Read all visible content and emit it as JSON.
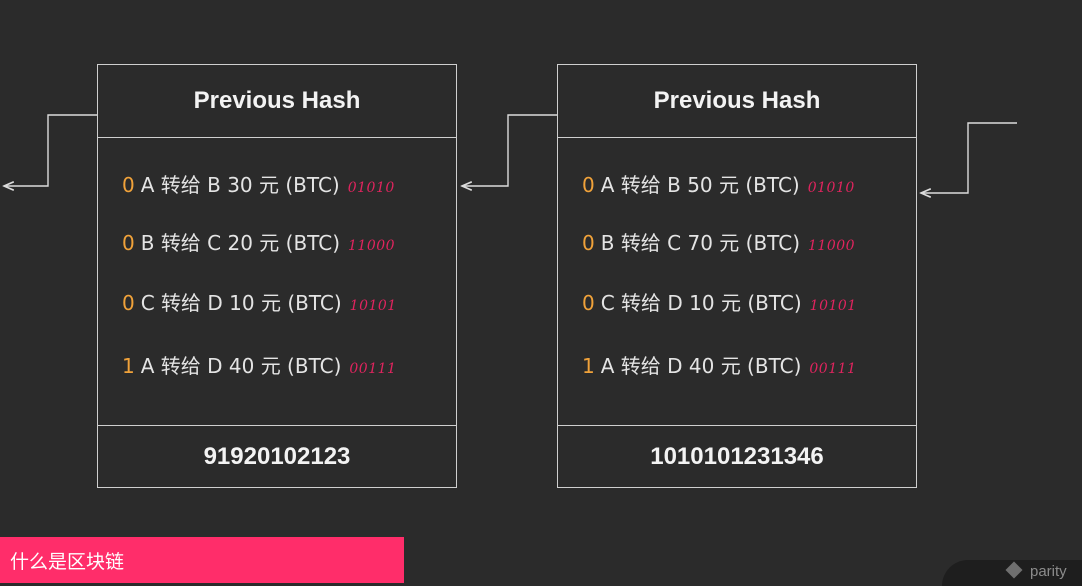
{
  "blocks": [
    {
      "header": "Previous Hash",
      "transactions": [
        {
          "flag": "0",
          "text": "A 转给 B 30 元 (BTC)",
          "bits": "01010"
        },
        {
          "flag": "0",
          "text": "B 转给 C 20 元 (BTC)",
          "bits": "11000"
        },
        {
          "flag": "0",
          "text": "C 转给 D 10 元 (BTC)",
          "bits": "10101"
        },
        {
          "flag": "1",
          "text": "A 转给 D 40 元 (BTC)",
          "bits": "00111"
        }
      ],
      "hash": "91920102123"
    },
    {
      "header": "Previous Hash",
      "transactions": [
        {
          "flag": "0",
          "text": "A 转给 B 50 元 (BTC)",
          "bits": "01010"
        },
        {
          "flag": "0",
          "text": "B 转给 C 70 元 (BTC)",
          "bits": "11000"
        },
        {
          "flag": "0",
          "text": "C 转给 D 10 元 (BTC)",
          "bits": "10101"
        },
        {
          "flag": "1",
          "text": "A 转给 D 40 元 (BTC)",
          "bits": "00111"
        }
      ],
      "hash": "1010101231346"
    }
  ],
  "caption": "什么是区块链",
  "brand": "parity",
  "colors": {
    "background": "#2b2b2b",
    "border": "#cfcfcf",
    "flag": "#f0a23a",
    "bits": "#e0245e",
    "caption_bg": "#ff2d6a"
  }
}
